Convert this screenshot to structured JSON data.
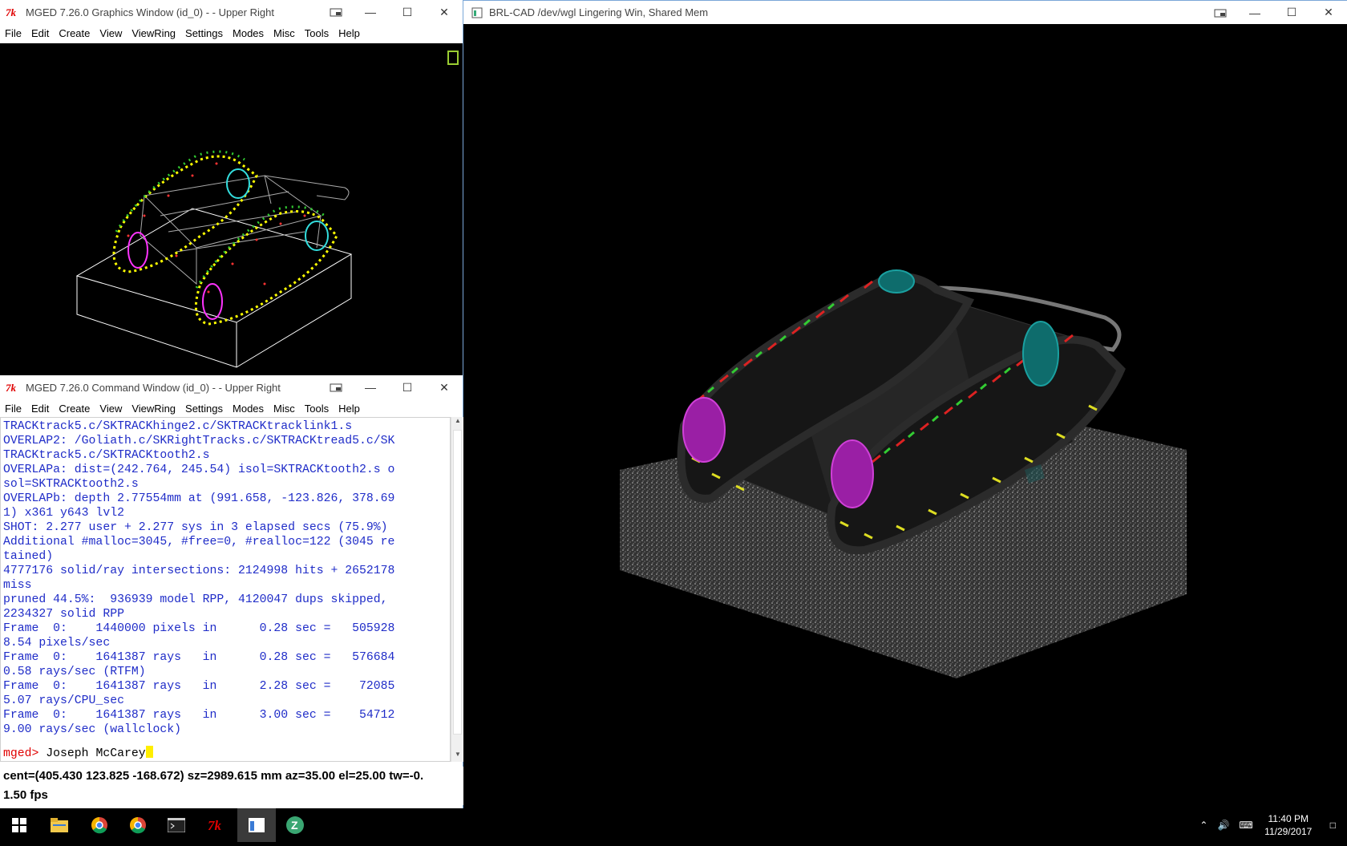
{
  "graphics_window": {
    "title": "MGED 7.26.0 Graphics Window (id_0) -  - Upper Right",
    "menu": [
      "File",
      "Edit",
      "Create",
      "View",
      "ViewRing",
      "Settings",
      "Modes",
      "Misc",
      "Tools",
      "Help"
    ]
  },
  "command_window": {
    "title": "MGED 7.26.0 Command Window (id_0) -  - Upper Right",
    "menu": [
      "File",
      "Edit",
      "Create",
      "View",
      "ViewRing",
      "Settings",
      "Modes",
      "Misc",
      "Tools",
      "Help"
    ],
    "lines": [
      "TRACKtrack5.c/SKTRACKhinge2.c/SKTRACKtracklink1.s",
      "OVERLAP2: /Goliath.c/SKRightTracks.c/SKTRACKtread5.c/SK",
      "TRACKtrack5.c/SKTRACKtooth2.s",
      "OVERLAPa: dist=(242.764, 245.54) isol=SKTRACKtooth2.s o",
      "sol=SKTRACKtooth2.s",
      "OVERLAPb: depth 2.77554mm at (991.658, -123.826, 378.69",
      "1) x361 y643 lvl2",
      "SHOT: 2.277 user + 2.277 sys in 3 elapsed secs (75.9%)",
      "Additional #malloc=3045, #free=0, #realloc=122 (3045 re",
      "tained)",
      "4777176 solid/ray intersections: 2124998 hits + 2652178",
      "miss",
      "pruned 44.5%:  936939 model RPP, 4120047 dups skipped,",
      "2234327 solid RPP",
      "Frame  0:    1440000 pixels in      0.28 sec =   505928",
      "8.54 pixels/sec",
      "Frame  0:    1641387 rays   in      0.28 sec =   576684",
      "0.58 rays/sec (RTFM)",
      "Frame  0:    1641387 rays   in      2.28 sec =    72085",
      "5.07 rays/CPU_sec",
      "Frame  0:    1641387 rays   in      3.00 sec =    54712",
      "9.00 rays/sec (wallclock)"
    ],
    "prompt": "mged>",
    "input": " Joseph McCarey",
    "status_line": "cent=(405.430 123.825 -168.672) sz=2989.615  mm  az=35.00  el=25.00  tw=-0.",
    "fps": "1.50 fps"
  },
  "render_window": {
    "title": "BRL-CAD /dev/wgl Lingering Win, Shared Mem"
  },
  "taskbar": {
    "time": "11:40 PM",
    "date": "11/29/2017"
  }
}
